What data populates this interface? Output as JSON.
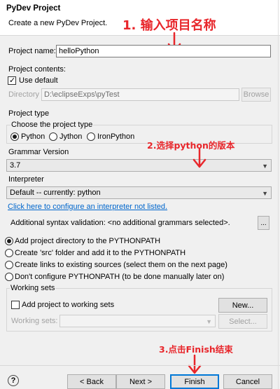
{
  "dialog": {
    "title": "PyDev Project",
    "description": "Create a new PyDev Project."
  },
  "annotations": {
    "step1": "1. 输入项目名称",
    "step2": "2.选择python的版本",
    "step3": "3.点击Finish结束",
    "color": "#e8262b"
  },
  "project_name": {
    "label": "Project name:",
    "value": "helloPython"
  },
  "contents": {
    "heading": "Project contents:",
    "use_default_label": "Use default",
    "use_default_checked": true,
    "directory_label": "Directory",
    "directory_value": "D:\\eclipseExps\\pyTest",
    "browse_label": "Browse"
  },
  "project_type": {
    "heading": "Project type",
    "group_label": "Choose the project type",
    "options": [
      "Python",
      "Jython",
      "IronPython"
    ],
    "selected": "Python"
  },
  "grammar": {
    "label": "Grammar Version",
    "value": "3.7"
  },
  "interpreter": {
    "label": "Interpreter",
    "value": "Default  --  currently: python",
    "config_link": "Click here to configure an interpreter not listed."
  },
  "syntax": {
    "label": "Additional syntax validation: <no additional grammars selected>.",
    "button": "..."
  },
  "pythonpath": {
    "options": [
      "Add project directory to the PYTHONPATH",
      "Create 'src' folder and add it to the PYTHONPATH",
      "Create links to existing sources (select them on the next page)",
      "Don't configure PYTHONPATH (to be done manually later on)"
    ],
    "selected_index": 0
  },
  "working_sets": {
    "group_label": "Working sets",
    "add_label": "Add project to working sets",
    "new_button": "New...",
    "sets_label": "Working sets:",
    "select_button": "Select..."
  },
  "footer": {
    "help": "?",
    "back": "< Back",
    "next": "Next >",
    "finish": "Finish",
    "cancel": "Cancel"
  }
}
